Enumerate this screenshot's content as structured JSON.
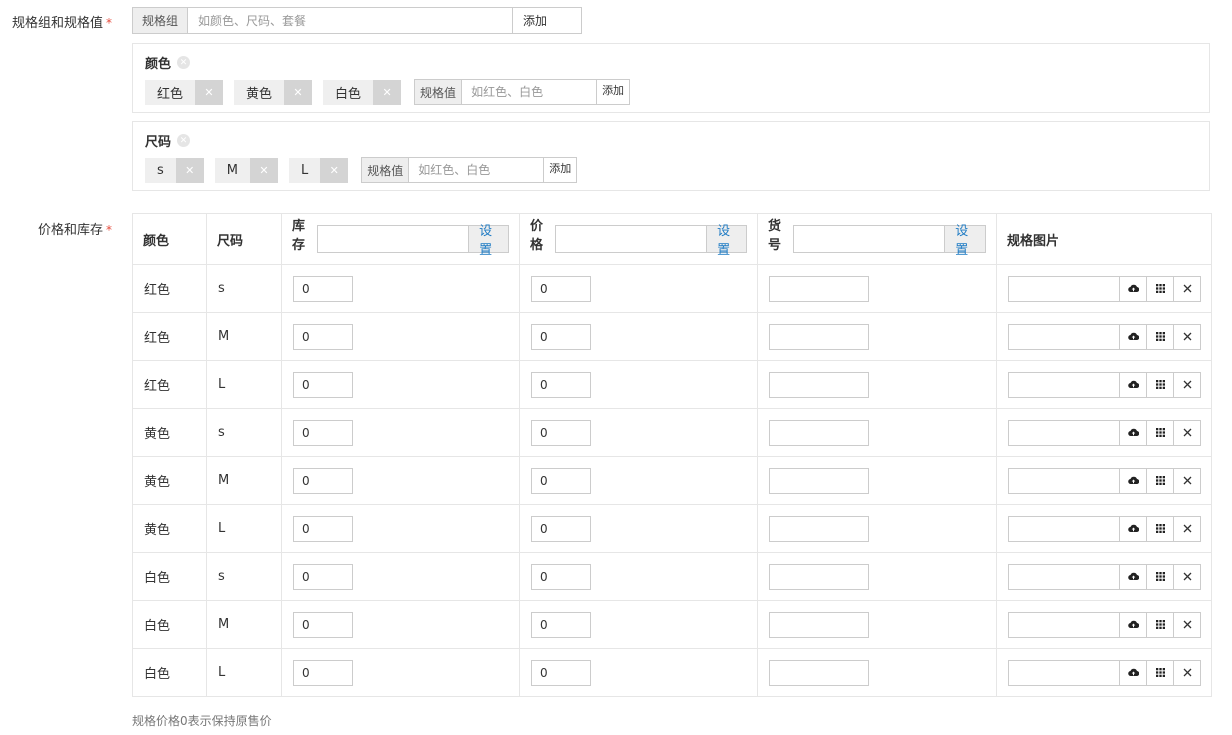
{
  "spec_section": {
    "label": "规格组和规格值",
    "group_addon": "规格组",
    "group_placeholder": "如颜色、尺码、套餐",
    "add_label": "添加",
    "value_addon": "规格值",
    "value_placeholder": "如红色、白色",
    "groups": [
      {
        "name": "颜色",
        "values": [
          "红色",
          "黄色",
          "白色"
        ]
      },
      {
        "name": "尺码",
        "values": [
          "s",
          "M",
          "L"
        ]
      }
    ]
  },
  "stock_section": {
    "label": "价格和库存",
    "set_label": "设置",
    "headers": {
      "color": "颜色",
      "size": "尺码",
      "stock": "库存",
      "price": "价格",
      "sn": "货号",
      "image": "规格图片"
    },
    "rows": [
      {
        "color": "红色",
        "size": "s",
        "stock": "0",
        "price": "0",
        "sn": ""
      },
      {
        "color": "红色",
        "size": "M",
        "stock": "0",
        "price": "0",
        "sn": ""
      },
      {
        "color": "红色",
        "size": "L",
        "stock": "0",
        "price": "0",
        "sn": ""
      },
      {
        "color": "黄色",
        "size": "s",
        "stock": "0",
        "price": "0",
        "sn": ""
      },
      {
        "color": "黄色",
        "size": "M",
        "stock": "0",
        "price": "0",
        "sn": ""
      },
      {
        "color": "黄色",
        "size": "L",
        "stock": "0",
        "price": "0",
        "sn": ""
      },
      {
        "color": "白色",
        "size": "s",
        "stock": "0",
        "price": "0",
        "sn": ""
      },
      {
        "color": "白色",
        "size": "M",
        "stock": "0",
        "price": "0",
        "sn": ""
      },
      {
        "color": "白色",
        "size": "L",
        "stock": "0",
        "price": "0",
        "sn": ""
      }
    ],
    "note": "规格价格0表示保持原售价"
  }
}
